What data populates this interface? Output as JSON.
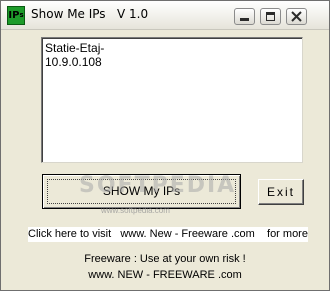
{
  "window": {
    "title": "Show Me IPs   V 1.0",
    "icon_text": "IP",
    "icon_sub": "s",
    "controls": {
      "minimize": "minimize-icon",
      "maximize": "maximize-icon",
      "close": "close-icon"
    }
  },
  "output": {
    "lines": [
      "Statie-Etaj-",
      "10.9.0.108"
    ]
  },
  "buttons": {
    "show_label": "SHOW My IPs",
    "exit_label": "Exit"
  },
  "watermark": {
    "text": "SOFTPEDIA",
    "url": "www.softpedia.com"
  },
  "links": {
    "visit": "Click here to visit   www. New - Freeware .com    for more"
  },
  "footer": {
    "line1": "Freeware : Use at your own risk !",
    "line2": "www. NEW - FREEWARE .com"
  },
  "colors": {
    "window_bg": "#ece9d8",
    "icon_green": "#1d9b2a"
  }
}
